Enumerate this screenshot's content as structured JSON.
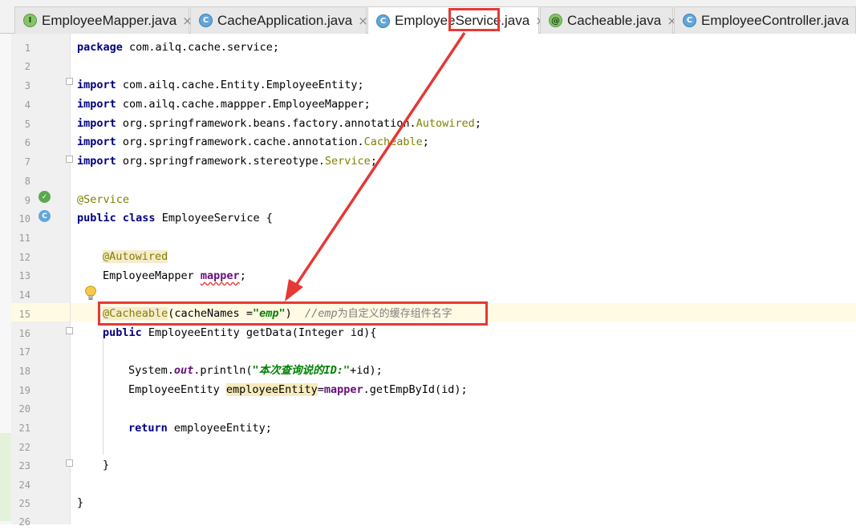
{
  "tabs": [
    {
      "label": "EmployeeMapper.java",
      "icon": "interface-icon",
      "active": false
    },
    {
      "label": "CacheApplication.java",
      "icon": "spring-app-class-icon",
      "active": false
    },
    {
      "label": "EmployeeService.java",
      "icon": "class-icon",
      "active": true
    },
    {
      "label": "Cacheable.java",
      "icon": "annotation-icon",
      "active": false
    },
    {
      "label": "EmployeeController.java",
      "icon": "class-icon",
      "active": false
    }
  ],
  "close_glyph": "×",
  "line_numbers": [
    "1",
    "2",
    "3",
    "4",
    "5",
    "6",
    "7",
    "8",
    "9",
    "10",
    "11",
    "12",
    "13",
    "14",
    "15",
    "16",
    "17",
    "18",
    "19",
    "20",
    "21",
    "22",
    "23",
    "24",
    "25",
    "26"
  ],
  "code": {
    "l1": {
      "kw": "package",
      "rest": " com.ailq.cache.service;"
    },
    "l3": {
      "kw": "import",
      "rest": " com.ailq.cache.Entity.EmployeeEntity;"
    },
    "l4": {
      "kw": "import",
      "rest": " com.ailq.cache.mappper.EmployeeMapper;"
    },
    "l5": {
      "kw": "import",
      "pre": " org.springframework.beans.factory.annotation.",
      "ann": "Autowired",
      "end": ";"
    },
    "l6": {
      "kw": "import",
      "pre": " org.springframework.cache.annotation.",
      "ann": "Cacheable",
      "end": ";"
    },
    "l7": {
      "kw": "import",
      "pre": " org.springframework.stereotype.",
      "ann": "Service",
      "end": ";"
    },
    "l9": {
      "ann": "@Service"
    },
    "l10": {
      "kw1": "public",
      "kw2": "class",
      "rest": " EmployeeService {"
    },
    "l12": {
      "ann": "@Autowired"
    },
    "l13": {
      "type": "EmployeeMapper ",
      "field": "mapper",
      "end": ";"
    },
    "l15": {
      "ann": "@Cacheable",
      "pre": "(cacheNames =",
      "str": "\"emp\"",
      "post": ")  ",
      "cmt_it": "//emp",
      "cmt": "为自定义的缓存组件名字"
    },
    "l16": {
      "kw": "public",
      "rest": " EmployeeEntity getData(Integer id){"
    },
    "l18": {
      "pre": "System.",
      "static": "out",
      "mid": ".println(",
      "str": "\"本次查询说的ID:\"",
      "end": "+id);"
    },
    "l19": {
      "type": "EmployeeEntity ",
      "var": "employeeEntity",
      "eq": "=",
      "field": "mapper",
      "end": ".getEmpById(id);"
    },
    "l21": {
      "kw": "return",
      "rest": " employeeEntity;"
    },
    "l23": {
      "text": "}"
    },
    "l25": {
      "text": "}"
    }
  },
  "colors": {
    "keyword": "#000080",
    "annotation": "#808000",
    "string": "#008000",
    "comment": "#808080",
    "field": "#660e7a",
    "callout": "#e53935",
    "caret_line": "#fffae3"
  }
}
